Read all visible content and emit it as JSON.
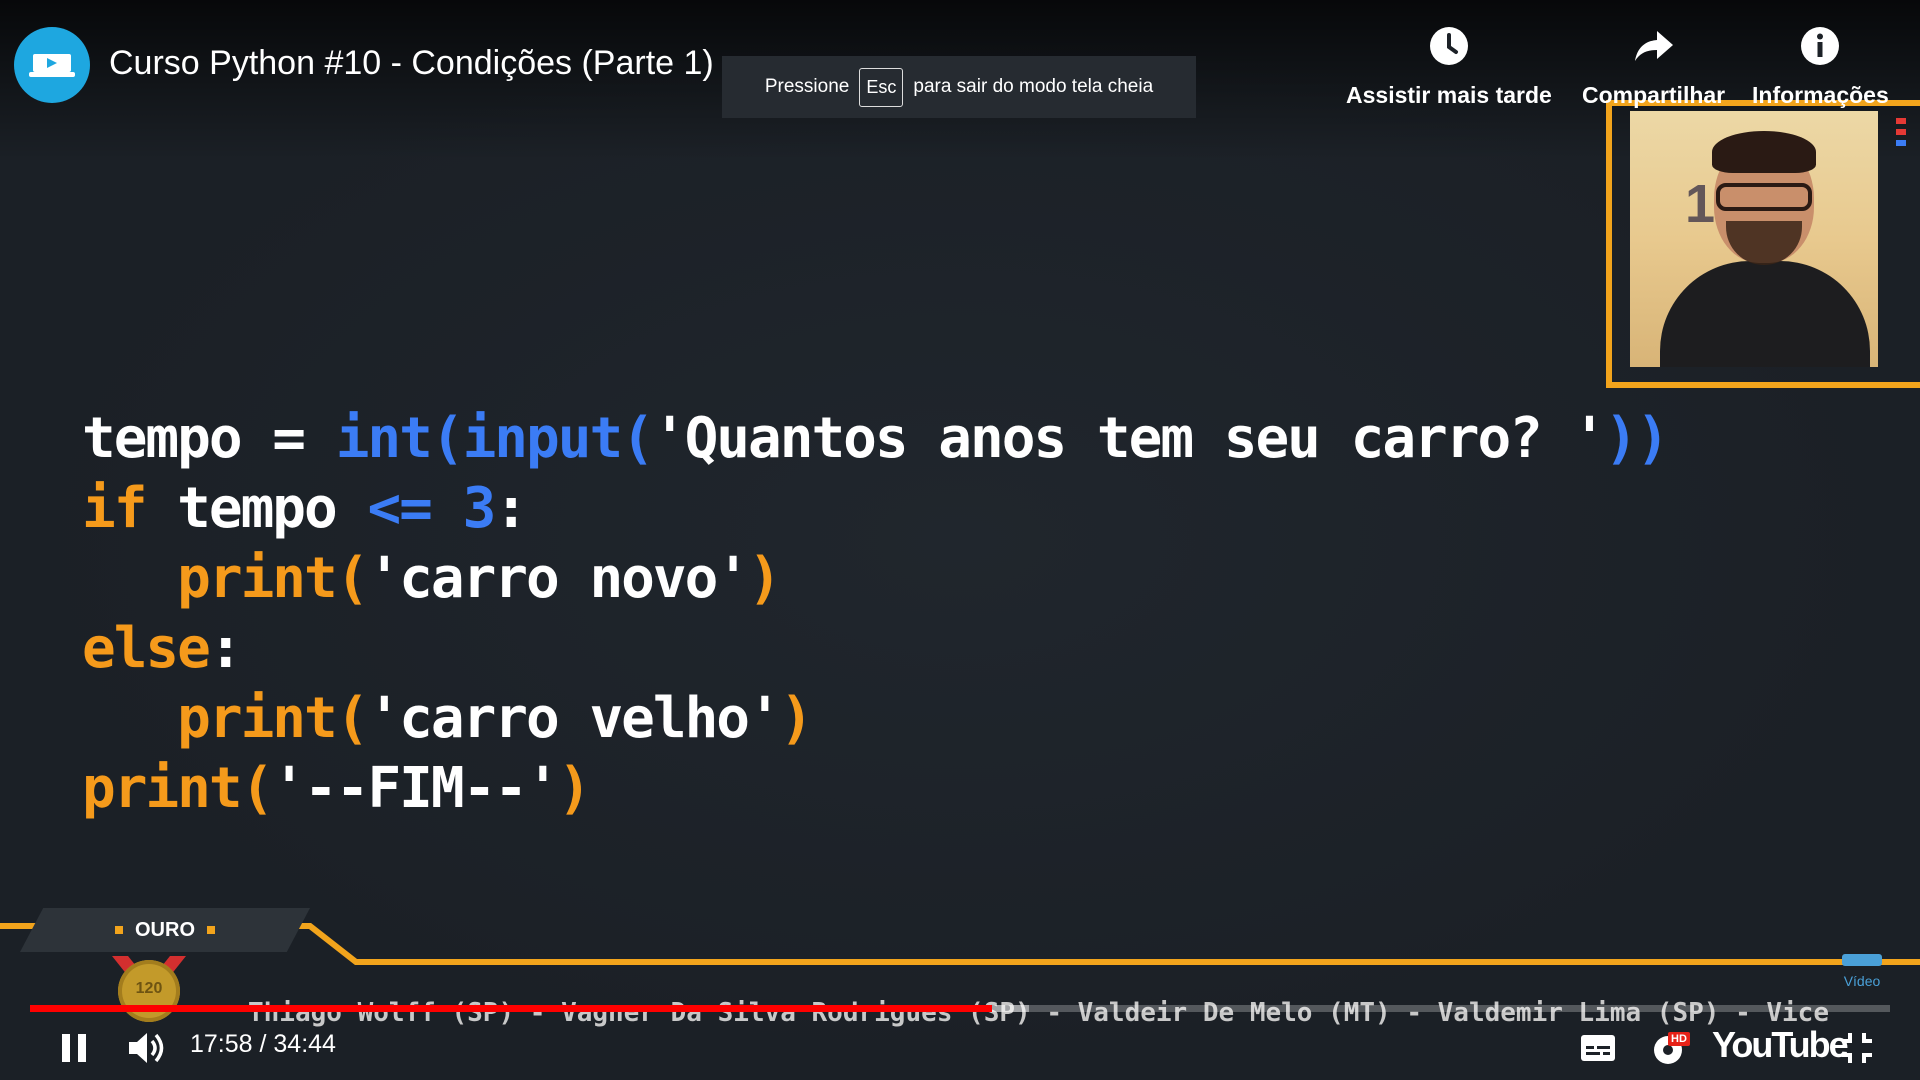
{
  "header": {
    "title": "Curso Python #10 - Condições (Parte 1)",
    "channel_icon": "channel-logo-icon"
  },
  "fullscreen_toast": {
    "prefix": "Pressione",
    "key": "Esc",
    "suffix": "para sair do modo tela cheia"
  },
  "top_actions": [
    {
      "label": "Assistir mais tarde",
      "icon": "clock-icon"
    },
    {
      "label": "Compartilhar",
      "icon": "share-icon"
    },
    {
      "label": "Informações",
      "icon": "info-icon"
    }
  ],
  "code_lines": [
    [
      {
        "t": "tempo = ",
        "c": "w"
      },
      {
        "t": "int(input(",
        "c": "b"
      },
      {
        "t": "'Quantos anos tem seu carro? '",
        "c": "w"
      },
      {
        "t": "))",
        "c": "b"
      }
    ],
    [
      {
        "t": "if ",
        "c": "o"
      },
      {
        "t": "tempo ",
        "c": "w"
      },
      {
        "t": "<= 3",
        "c": "b"
      },
      {
        "t": ":",
        "c": "w"
      }
    ],
    [
      {
        "t": "   print(",
        "c": "o"
      },
      {
        "t": "'carro novo'",
        "c": "w"
      },
      {
        "t": ")",
        "c": "o"
      }
    ],
    [
      {
        "t": "else",
        "c": "o"
      },
      {
        "t": ":",
        "c": "w"
      }
    ],
    [
      {
        "t": "   print(",
        "c": "o"
      },
      {
        "t": "'carro velho'",
        "c": "w"
      },
      {
        "t": ")",
        "c": "o"
      }
    ],
    [
      {
        "t": "print(",
        "c": "o"
      },
      {
        "t": "'--FIM--'",
        "c": "w"
      },
      {
        "t": ")",
        "c": "o"
      }
    ]
  ],
  "overlay": {
    "tier": "OURO",
    "medal_number": "120",
    "ticker": "Thiago Wolff (SP) - Vagner Da Silva Rodrigues (SP) - Valdeir De Melo (MT) - Valdemir Lima (SP) - Vice",
    "brand_mini": "Vídeo"
  },
  "player": {
    "current_time": "17:58",
    "duration": "34:44",
    "time_display": "17:58 / 34:44",
    "progress_fraction": 0.517,
    "buffered_fraction": 0.537,
    "hd_badge": "HD",
    "logo_text": "YouTube",
    "icons": [
      "pause-icon",
      "volume-icon",
      "subtitles-icon",
      "settings-icon",
      "exit-fullscreen-icon"
    ]
  },
  "colors": {
    "accent_orange": "#f2a41c",
    "code_blue": "#3b7cf5",
    "code_orange": "#f59a1b",
    "progress_red": "#ff0000",
    "channel_blue": "#1ea7e0"
  }
}
